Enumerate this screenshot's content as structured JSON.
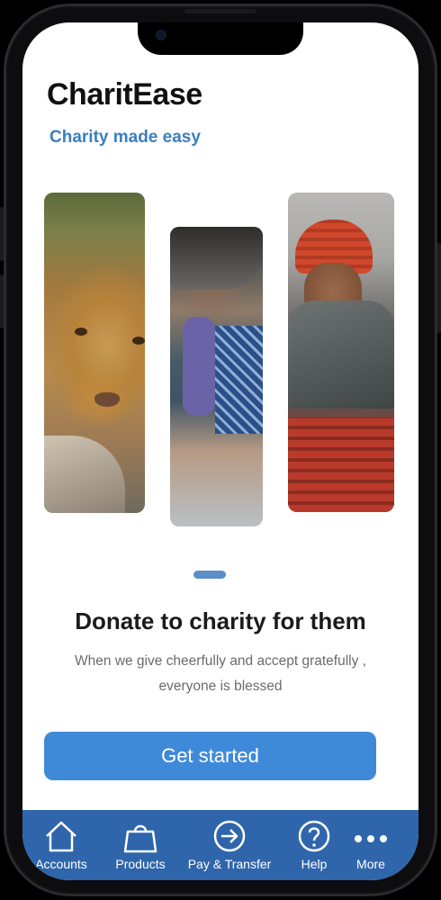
{
  "app": {
    "title": "CharitEase",
    "tagline": "Charity made easy"
  },
  "carousel": {
    "images": [
      {
        "subject": "lion cub"
      },
      {
        "subject": "woman working"
      },
      {
        "subject": "smiling elderly woman"
      }
    ],
    "active_page": 1
  },
  "onboarding": {
    "headline": "Donate to charity for them",
    "subtext": "When we give cheerfully and accept gratefully , everyone is blessed",
    "cta_label": "Get started"
  },
  "bottom_nav": {
    "items": [
      {
        "label": "Accounts",
        "icon": "home-icon"
      },
      {
        "label": "Products",
        "icon": "shopping-bag-icon"
      },
      {
        "label": "Pay & Transfer",
        "icon": "arrow-circle-icon"
      },
      {
        "label": "Help",
        "icon": "question-circle-icon"
      },
      {
        "label": "More",
        "icon": "more-dots-icon"
      }
    ]
  },
  "colors": {
    "accent": "#3f8ad8",
    "tagline": "#3a7fc1",
    "nav_background": "#2f66ab",
    "indicator": "#5c8fc9"
  }
}
